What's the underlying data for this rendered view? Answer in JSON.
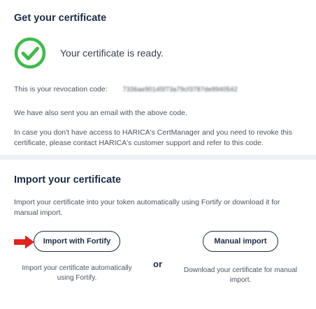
{
  "get_section": {
    "title": "Get your certificate",
    "status_message": "Your certificate is ready.",
    "check_color": "#3dbb4a",
    "revocation_label": "This is your revocation code:",
    "revocation_code": "7336ae90145f73a79cf3787de9940542",
    "email_note": "We have also sent you an email with the above code.",
    "revoke_note": "In case you don't have access to HARICA's CertManager and you need to revoke this certificate, please contact HARICA's customer support and refer to this code."
  },
  "import_section": {
    "title": "Import your certificate",
    "description": "Import your certificate into your token automatically using Fortify or download it for manual import.",
    "fortify_button": "Import with Fortify",
    "manual_button": "Manual import",
    "separator": "or",
    "fortify_caption": "Import your certificate automatically using Fortify.",
    "manual_caption": "Download your certificate for manual import.",
    "pointer_color": "#e0231c"
  }
}
